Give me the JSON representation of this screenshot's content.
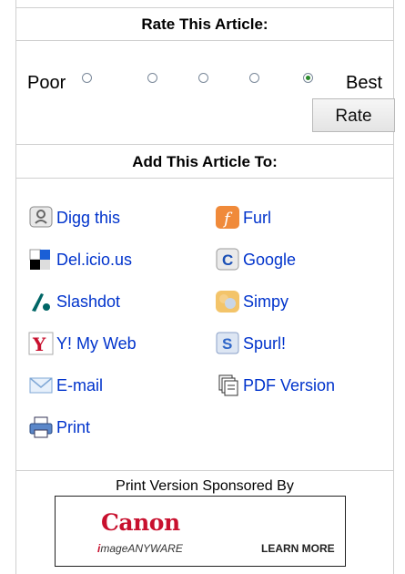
{
  "rate": {
    "title": "Rate This Article:",
    "poor_label": "Poor",
    "best_label": "Best",
    "options_count": 5,
    "selected_index": 4,
    "button_label": "Rate"
  },
  "add": {
    "title": "Add This Article To:",
    "items": [
      {
        "label": "Digg this",
        "icon": "digg-icon"
      },
      {
        "label": "Furl",
        "icon": "furl-icon"
      },
      {
        "label": "Del.icio.us",
        "icon": "delicious-icon"
      },
      {
        "label": "Google",
        "icon": "google-icon"
      },
      {
        "label": "Slashdot",
        "icon": "slashdot-icon"
      },
      {
        "label": "Simpy",
        "icon": "simpy-icon"
      },
      {
        "label": "Y! My Web",
        "icon": "yahoo-icon"
      },
      {
        "label": "Spurl!",
        "icon": "spurl-icon"
      },
      {
        "label": "E-mail",
        "icon": "email-icon"
      },
      {
        "label": "PDF Version",
        "icon": "pdf-icon"
      },
      {
        "label": "Print",
        "icon": "print-icon"
      }
    ]
  },
  "sponsor": {
    "text": "Print Version Sponsored By",
    "brand": "Canon",
    "tagline_prefix": "i",
    "tagline_rest": "mageANYWARE",
    "cta": "LEARN MORE"
  },
  "colors": {
    "link": "#0033cc",
    "canon_red": "#c8102e"
  }
}
